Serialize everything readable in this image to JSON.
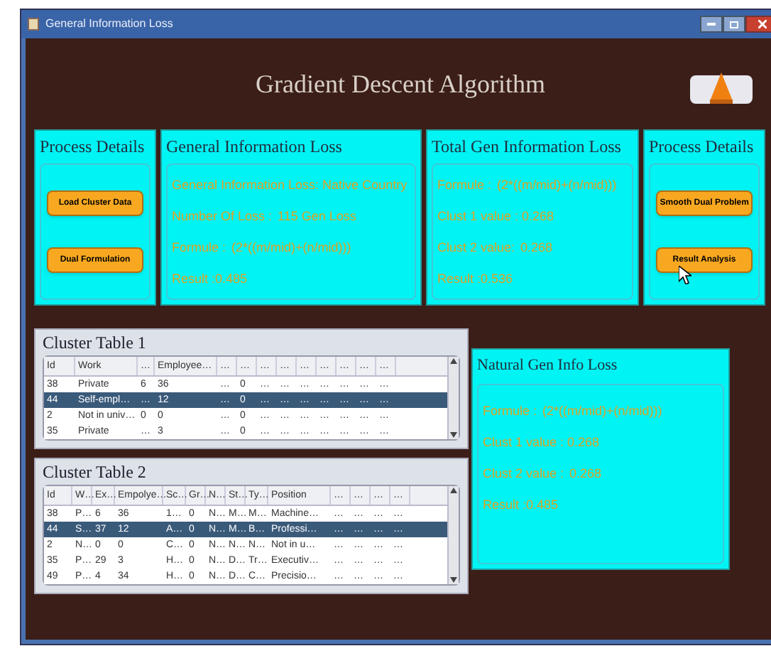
{
  "window": {
    "title": "General Information Loss"
  },
  "header": {
    "title": "Gradient Descent Algorithm"
  },
  "top_panels": [
    {
      "kind": "buttons",
      "title": "Process Details",
      "buttons": [
        "Load Cluster Data",
        "Dual Formulation"
      ]
    },
    {
      "kind": "lines",
      "title": "General Information Loss",
      "lines": [
        {
          "label": "General Information Loss: Native Country"
        },
        {
          "label": "Number Of Loss :",
          "value": "115 Gen Loss"
        },
        {
          "label": "Formule :",
          "value": "(2*((m/mid)+(n/mid)))"
        },
        {
          "label": "Result :0.485"
        }
      ]
    },
    {
      "kind": "lines",
      "title": "Total Gen  Information Loss",
      "lines": [
        {
          "label": "Formule :",
          "value": "(2*((m/mid)+(n/mid)))"
        },
        {
          "label": "Clust 1 value : 0.268"
        },
        {
          "label": "Clust 2 value:",
          "value": "0.268"
        },
        {
          "label": "Result :0.536"
        }
      ]
    },
    {
      "kind": "buttons",
      "title": "Process Details",
      "buttons": [
        "Smooth Dual Problem",
        "Result Analysis"
      ]
    }
  ],
  "tables": [
    {
      "title": "Cluster Table 1",
      "columns": [
        "Id",
        "Work",
        "…",
        "Employee…",
        "…",
        "…",
        "…",
        "…",
        "…",
        "…",
        "…",
        "…",
        "…"
      ],
      "rows": [
        {
          "selected": false,
          "cells": [
            "38",
            "Private",
            "6",
            "36",
            "…",
            "0",
            "…",
            "…",
            "…",
            "…",
            "…",
            "…",
            "…"
          ]
        },
        {
          "selected": true,
          "cells": [
            "44",
            "Self-empl…",
            "…",
            "12",
            "…",
            "0",
            "…",
            "…",
            "…",
            "…",
            "…",
            "…",
            "…"
          ]
        },
        {
          "selected": false,
          "cells": [
            "2",
            "Not in univ…",
            "0",
            "0",
            "…",
            "0",
            "…",
            "…",
            "…",
            "…",
            "…",
            "…",
            "…"
          ]
        },
        {
          "selected": false,
          "cells": [
            "35",
            "Private",
            "…",
            "3",
            "…",
            "0",
            "…",
            "…",
            "…",
            "…",
            "…",
            "…",
            "…"
          ]
        }
      ]
    },
    {
      "title": "Cluster Table 2",
      "columns": [
        "Id",
        "W…",
        "Ex…",
        "Empolye…",
        "Sc…",
        "Gr…",
        "N…",
        "St…",
        "Ty…",
        "Position",
        "…",
        "…",
        "…",
        "…"
      ],
      "rows": [
        {
          "selected": false,
          "cells": [
            "38",
            "P…",
            "6",
            "36",
            "1…",
            "0",
            "N…",
            "M…",
            "M…",
            "Machine…",
            "…",
            "…",
            "…",
            "…"
          ]
        },
        {
          "selected": true,
          "cells": [
            "44",
            "S…",
            "37",
            "12",
            "A…",
            "0",
            "N…",
            "M…",
            "B…",
            "Professi…",
            "…",
            "…",
            "…",
            "…"
          ]
        },
        {
          "selected": false,
          "cells": [
            "2",
            "N…",
            "0",
            "0",
            "C…",
            "0",
            "N…",
            "N…",
            "N…",
            "Not in u…",
            "…",
            "…",
            "…",
            "…"
          ]
        },
        {
          "selected": false,
          "cells": [
            "35",
            "P…",
            "29",
            "3",
            "H…",
            "0",
            "N…",
            "D…",
            "Tr…",
            "Executiv…",
            "…",
            "…",
            "…",
            "…"
          ]
        },
        {
          "selected": false,
          "cells": [
            "49",
            "P…",
            "4",
            "34",
            "H…",
            "0",
            "N…",
            "D…",
            "C…",
            "Precisio…",
            "…",
            "…",
            "…",
            "…"
          ]
        }
      ]
    }
  ],
  "side_panel": {
    "title": "Natural Gen Info Loss",
    "lines": [
      {
        "label": "Formule :",
        "value": "(2*((m/mid)+(n/mid)))"
      },
      {
        "label": "Clust 1 value : 0.268"
      },
      {
        "label": "Clust 2 value :",
        "value": "0.268"
      },
      {
        "label": "Result :0.485"
      }
    ]
  }
}
